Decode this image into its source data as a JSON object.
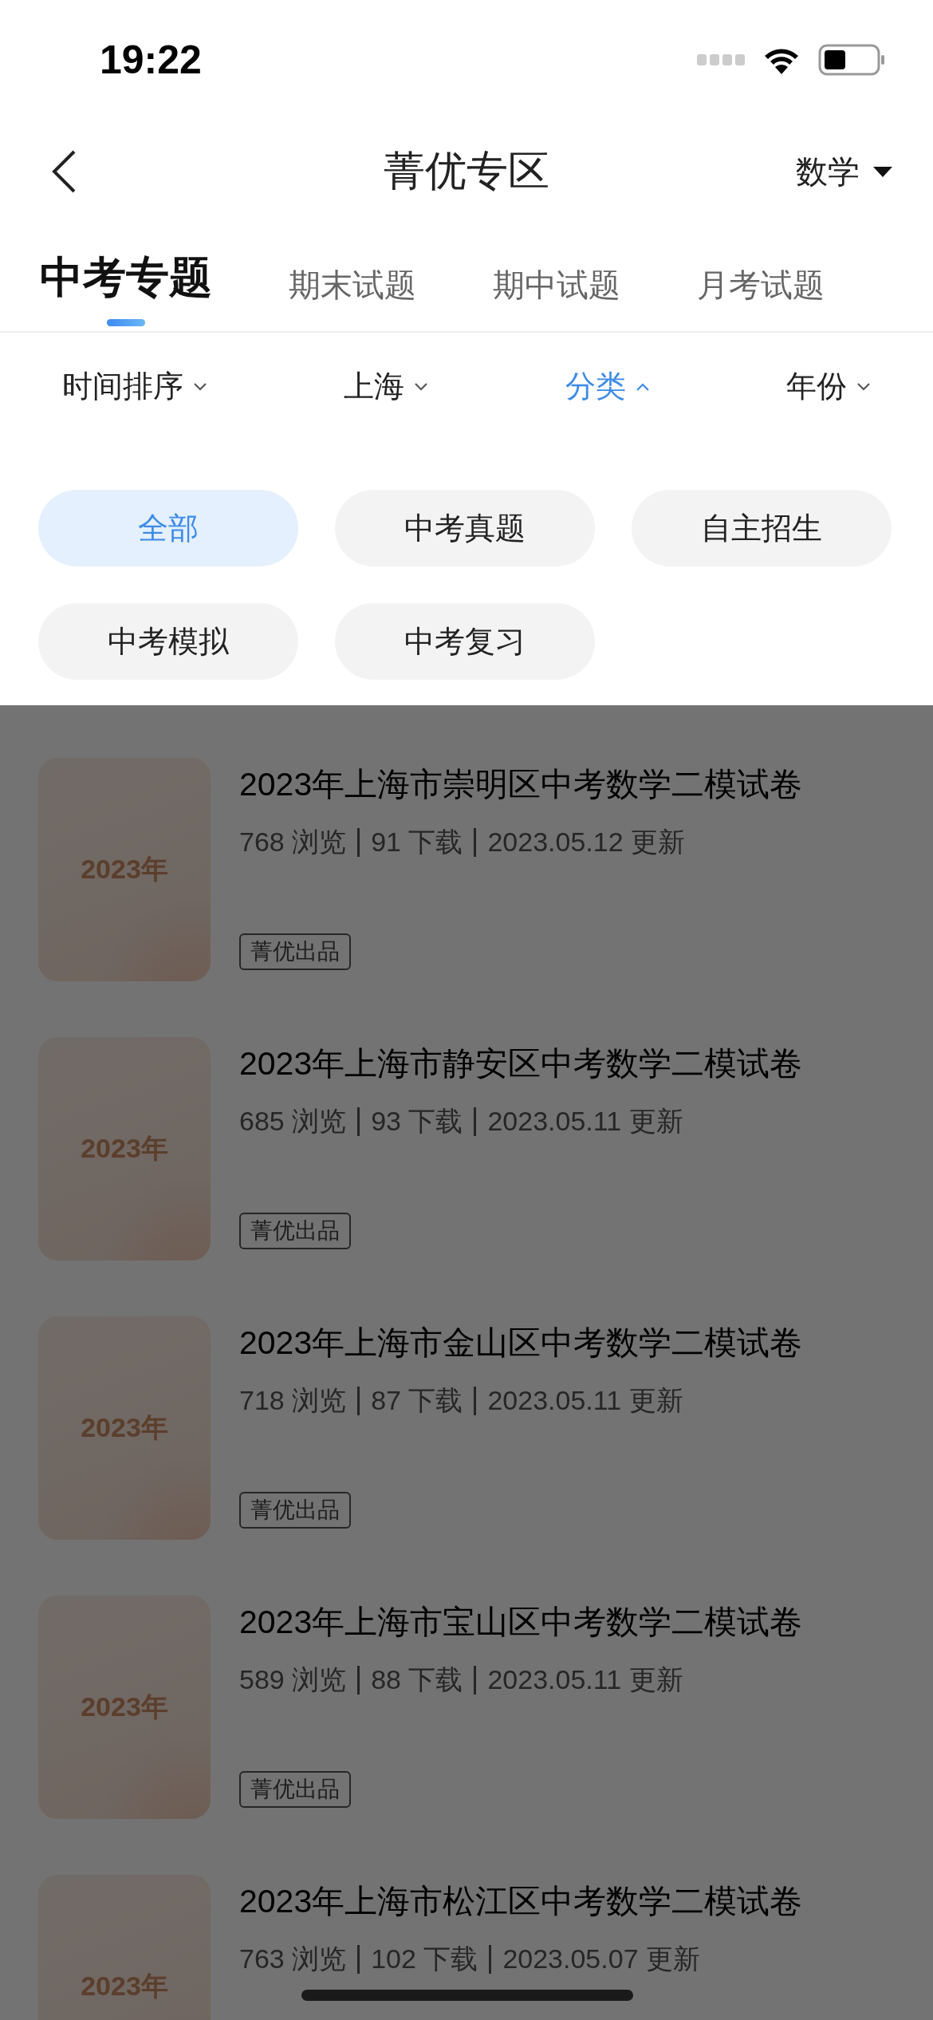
{
  "status_bar": {
    "time": "19:22"
  },
  "nav": {
    "title": "菁优专区",
    "subject": "数学"
  },
  "tabs": [
    {
      "label": "中考专题",
      "selected": true
    },
    {
      "label": "期末试题",
      "selected": false
    },
    {
      "label": "期中试题",
      "selected": false
    },
    {
      "label": "月考试题",
      "selected": false
    }
  ],
  "filters": [
    {
      "label": "时间排序",
      "selected": false
    },
    {
      "label": "上海",
      "selected": false
    },
    {
      "label": "分类",
      "selected": true
    },
    {
      "label": "年份",
      "selected": false
    }
  ],
  "categories": [
    {
      "label": "全部",
      "selected": true
    },
    {
      "label": "中考真题",
      "selected": false
    },
    {
      "label": "自主招生",
      "selected": false
    },
    {
      "label": "中考模拟",
      "selected": false
    },
    {
      "label": "中考复习",
      "selected": false
    }
  ],
  "papers": [
    {
      "cover": "2023年",
      "title": "2023年上海市崇明区中考数学二模试卷",
      "views": "768 浏览",
      "downloads": "91 下载",
      "updated": "2023.05.12 更新",
      "tag": "菁优出品"
    },
    {
      "cover": "2023年",
      "title": "2023年上海市静安区中考数学二模试卷",
      "views": "685 浏览",
      "downloads": "93 下载",
      "updated": "2023.05.11 更新",
      "tag": "菁优出品"
    },
    {
      "cover": "2023年",
      "title": "2023年上海市金山区中考数学二模试卷",
      "views": "718 浏览",
      "downloads": "87 下载",
      "updated": "2023.05.11 更新",
      "tag": "菁优出品"
    },
    {
      "cover": "2023年",
      "title": "2023年上海市宝山区中考数学二模试卷",
      "views": "589 浏览",
      "downloads": "88 下载",
      "updated": "2023.05.11 更新",
      "tag": "菁优出品"
    },
    {
      "cover": "2023年",
      "title": "2023年上海市松江区中考数学二模试卷",
      "views": "763 浏览",
      "downloads": "102 下载",
      "updated": "2023.05.07 更新"
    }
  ]
}
